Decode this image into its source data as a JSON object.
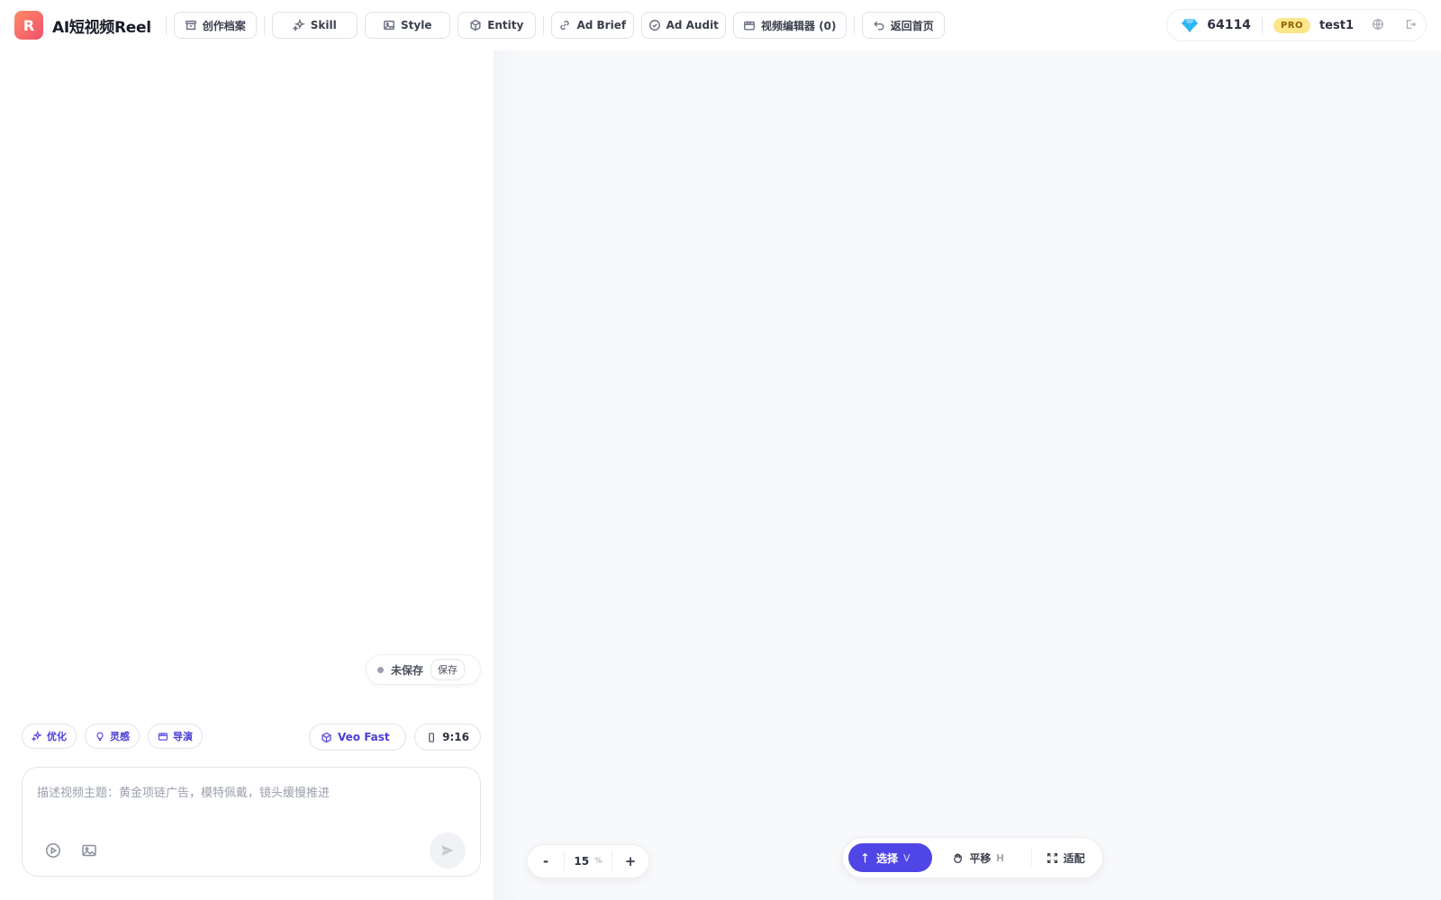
{
  "app": {
    "logo_letter": "R",
    "title": "AI短视频Reel"
  },
  "nav": [
    {
      "label": "创作档案",
      "icon": "archive-icon"
    },
    {
      "label": "Skill",
      "icon": "sparkle-icon"
    },
    {
      "label": "Style",
      "icon": "image-icon"
    },
    {
      "label": "Entity",
      "icon": "cube-icon"
    },
    {
      "label": "Ad Brief",
      "icon": "link-icon"
    },
    {
      "label": "Ad Audit",
      "icon": "check-circle-icon"
    },
    {
      "label": "视频编辑器 (0)",
      "icon": "clapper-icon"
    },
    {
      "label": "返回首页",
      "icon": "return-icon"
    }
  ],
  "account": {
    "credits": "64114",
    "badge": "PRO",
    "username": "test1"
  },
  "save": {
    "status": "未保存",
    "button": "保存"
  },
  "chips": [
    {
      "label": "优化",
      "icon": "sparkle-icon"
    },
    {
      "label": "灵感",
      "icon": "lightbulb-icon"
    },
    {
      "label": "导演",
      "icon": "clapper-icon"
    }
  ],
  "model": {
    "label": "Veo Fast"
  },
  "ratio": {
    "label": "9:16"
  },
  "composer": {
    "placeholder": "描述视频主题：黄金项链广告，模特佩戴，镜头缓慢推进"
  },
  "zoom": {
    "minus": "-",
    "value": "15",
    "unit": "%",
    "plus": "+"
  },
  "tools": [
    {
      "label": "选择",
      "key": "V",
      "active": true
    },
    {
      "label": "平移",
      "key": "H",
      "active": false
    },
    {
      "label": "适配",
      "key": "",
      "active": false
    }
  ],
  "colors": {
    "accent": "#4f46e5",
    "chip_text": "#4b3fd9",
    "pro_badge": "#fde68a"
  }
}
